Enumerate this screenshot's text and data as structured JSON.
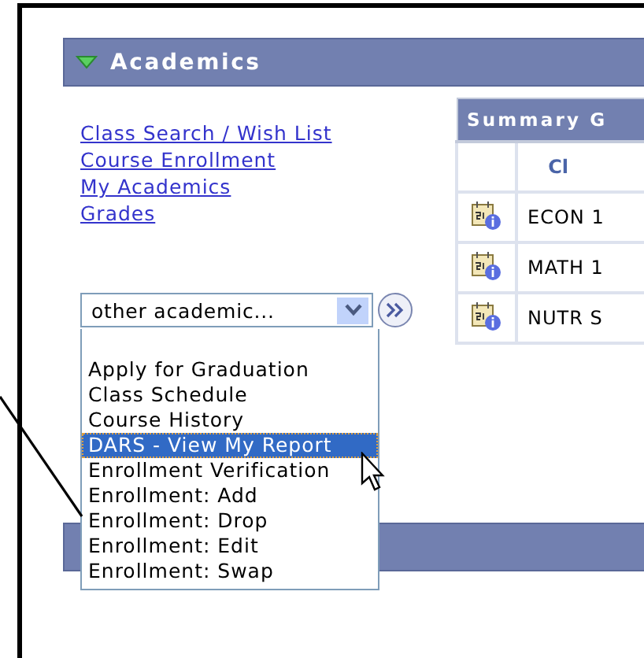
{
  "panel": {
    "title": "Academics",
    "expanded": true
  },
  "links": [
    "Class Search / Wish List",
    "Course Enrollment",
    "My Academics",
    "Grades"
  ],
  "summary_table": {
    "title": "Summary G",
    "column_heading": "Cl",
    "rows": [
      "ECON 1",
      "MATH 1",
      "NUTR S"
    ]
  },
  "academic_select": {
    "value": "other academic...",
    "options": [
      {
        "label": "Apply for Graduation",
        "selected": false
      },
      {
        "label": "Class Schedule",
        "selected": false
      },
      {
        "label": "Course History",
        "selected": false
      },
      {
        "label": "DARS - View My Report",
        "selected": true
      },
      {
        "label": "Enrollment Verification",
        "selected": false
      },
      {
        "label": "Enrollment: Add",
        "selected": false
      },
      {
        "label": "Enrollment: Drop",
        "selected": false
      },
      {
        "label": "Enrollment: Edit",
        "selected": false
      },
      {
        "label": "Enrollment: Swap",
        "selected": false
      }
    ]
  }
}
